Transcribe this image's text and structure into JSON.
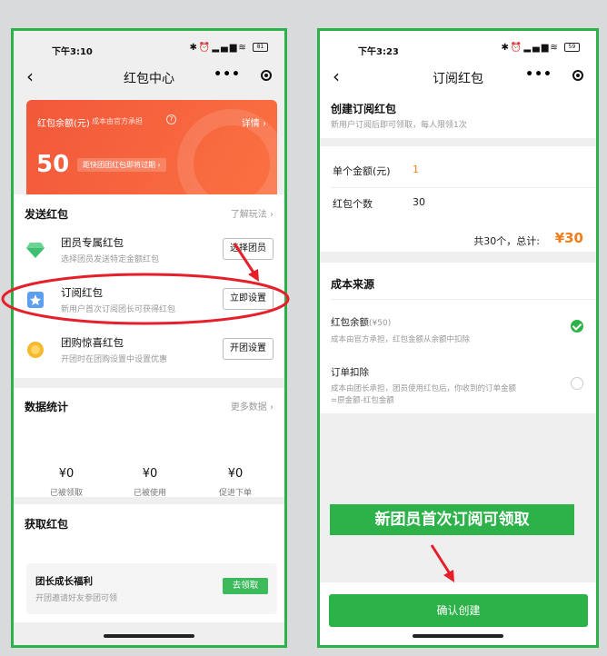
{
  "left": {
    "status_time": "下午3:10",
    "battery": "81",
    "nav_title": "红包中心",
    "balance": {
      "label": "红包余额(元)",
      "subtitle": "成本由官方承担",
      "detail_link": "详情 ›",
      "amount": "50",
      "expire_note": "距快团团红包即将过期 ›"
    },
    "send_section": {
      "title": "发送红包",
      "link": "了解玩法 ›",
      "items": [
        {
          "name": "团员专属红包",
          "desc": "选择团员发送特定金额红包",
          "button": "选择团员"
        },
        {
          "name": "订阅红包",
          "desc": "新用户首次订阅团长可获得红包",
          "button": "立即设置"
        },
        {
          "name": "团购惊喜红包",
          "desc": "开团时在团购设置中设置优惠",
          "button": "开团设置"
        }
      ]
    },
    "stats_section": {
      "title": "数据统计",
      "link": "更多数据 ›",
      "stats": [
        {
          "value": "¥0",
          "label": "已被领取"
        },
        {
          "value": "¥0",
          "label": "已被使用"
        },
        {
          "value": "¥0",
          "label": "促进下单"
        }
      ]
    },
    "get_section": {
      "title": "获取红包",
      "welfare_title": "团长成长福利",
      "welfare_desc": "开团邀请好友参团可领",
      "welfare_button": "去领取"
    }
  },
  "right": {
    "status_time": "下午3:23",
    "battery": "59",
    "nav_title": "订阅红包",
    "create_title": "创建订阅红包",
    "create_desc": "新用户订阅后即可领取，每人限领1次",
    "amount_label": "单个金额(元)",
    "amount_value": "1",
    "count_label": "红包个数",
    "count_value": "30",
    "total_prefix": "共30个，总计:",
    "total_value": "¥30",
    "cost_title": "成本来源",
    "option1_title": "红包余额",
    "option1_amount": "(¥50)",
    "option1_desc": "成本由官方承担，红包金额从余额中扣除",
    "option2_title": "订单扣除",
    "option2_desc1": "成本由团长承担，团员使用红包后，你收到的订单金额",
    "option2_desc2": "=原金额-红包金额",
    "banner": "新团员首次订阅可领取",
    "confirm_button": "确认创建"
  },
  "colors": {
    "frame_green": "#2db24a",
    "balance_orange": "#f2583a",
    "total_orange": "#f07d1a",
    "annotation_red": "#e5202a"
  }
}
